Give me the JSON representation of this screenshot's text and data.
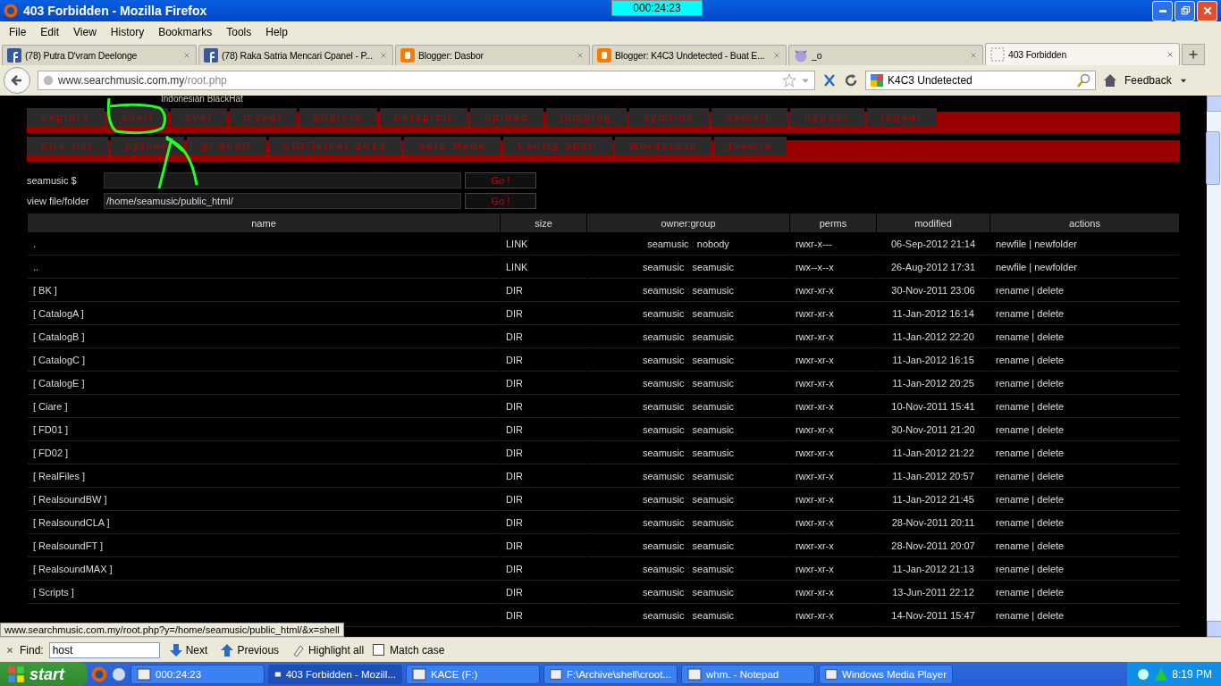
{
  "window": {
    "title": "403 Forbidden - Mozilla Firefox",
    "timer": "000:24:23"
  },
  "menu": [
    "File",
    "Edit",
    "View",
    "History",
    "Bookmarks",
    "Tools",
    "Help"
  ],
  "tabs": [
    {
      "label": "(78) Putra D'vram Deelonge",
      "kind": "facebook",
      "selected": false
    },
    {
      "label": "(78) Raka Satria Mencari Cpanel - P...",
      "kind": "facebook",
      "selected": false
    },
    {
      "label": "Blogger: Dasbor",
      "kind": "blogger",
      "selected": false
    },
    {
      "label": "Blogger: K4C3 Undetected - Buat E...",
      "kind": "blogger",
      "selected": false
    },
    {
      "label": "_o",
      "kind": "devil",
      "selected": false
    },
    {
      "label": "403 Forbidden",
      "kind": "blank",
      "selected": true
    }
  ],
  "navbar": {
    "url_host": "www.searchmusic.com.my",
    "url_path": "/root.php",
    "search": "K4C3 Undetected",
    "feedback": "Feedback"
  },
  "page": {
    "banner": "Indonesian BlackHat",
    "menu_rows": [
      [
        "explore",
        "shell",
        "eval",
        "mysql",
        "phpinfo",
        "netsploit",
        "upload",
        "jumping",
        "symlink",
        "domain",
        "bypass",
        "logout"
      ],
      [
        "Site list",
        "python",
        "gi Shell",
        "CGI-Telnet 2012",
        "Safe Mode",
        "Config Sh3ll",
        "Wordpress",
        "Joomla"
      ]
    ],
    "fields": [
      {
        "label": "seamusic $",
        "button": "Go !"
      },
      {
        "label": "view file/folder",
        "value": "/home/seamusic/public_html/",
        "button": "Go !"
      }
    ],
    "table": {
      "owner_group_separator": ":",
      "columns": [
        "name",
        "size",
        "owner:group",
        "perms",
        "modified",
        "actions"
      ],
      "rows": [
        {
          "name": ".",
          "size": "LINK",
          "owner": "seamusic",
          "group": "nobody",
          "perms": "rwxr-x---",
          "modified": "06-Sep-2012 21:14",
          "actions": "newfile | newfolder"
        },
        {
          "name": "..",
          "size": "LINK",
          "owner": "seamusic",
          "group": "seamusic",
          "perms": "rwx--x--x",
          "modified": "26-Aug-2012 17:31",
          "actions": "newfile | newfolder"
        },
        {
          "name": "[ BK ]",
          "size": "DIR",
          "owner": "seamusic",
          "group": "seamusic",
          "perms": "rwxr-xr-x",
          "modified": "30-Nov-2011 23:06",
          "actions": "rename | delete"
        },
        {
          "name": "[ CatalogA ]",
          "size": "DIR",
          "owner": "seamusic",
          "group": "seamusic",
          "perms": "rwxr-xr-x",
          "modified": "11-Jan-2012 16:14",
          "actions": "rename | delete"
        },
        {
          "name": "[ CatalogB ]",
          "size": "DIR",
          "owner": "seamusic",
          "group": "seamusic",
          "perms": "rwxr-xr-x",
          "modified": "11-Jan-2012 22:20",
          "actions": "rename | delete"
        },
        {
          "name": "[ CatalogC ]",
          "size": "DIR",
          "owner": "seamusic",
          "group": "seamusic",
          "perms": "rwxr-xr-x",
          "modified": "11-Jan-2012 16:15",
          "actions": "rename | delete"
        },
        {
          "name": "[ CatalogE ]",
          "size": "DIR",
          "owner": "seamusic",
          "group": "seamusic",
          "perms": "rwxr-xr-x",
          "modified": "11-Jan-2012 20:25",
          "actions": "rename | delete"
        },
        {
          "name": "[ Ciare ]",
          "size": "DIR",
          "owner": "seamusic",
          "group": "seamusic",
          "perms": "rwxr-xr-x",
          "modified": "10-Nov-2011 15:41",
          "actions": "rename | delete"
        },
        {
          "name": "[ FD01 ]",
          "size": "DIR",
          "owner": "seamusic",
          "group": "seamusic",
          "perms": "rwxr-xr-x",
          "modified": "30-Nov-2011 21:20",
          "actions": "rename | delete"
        },
        {
          "name": "[ FD02 ]",
          "size": "DIR",
          "owner": "seamusic",
          "group": "seamusic",
          "perms": "rwxr-xr-x",
          "modified": "11-Jan-2012 21:22",
          "actions": "rename | delete"
        },
        {
          "name": "[ RealFiles ]",
          "size": "DIR",
          "owner": "seamusic",
          "group": "seamusic",
          "perms": "rwxr-xr-x",
          "modified": "11-Jan-2012 20:57",
          "actions": "rename | delete"
        },
        {
          "name": "[ RealsoundBW ]",
          "size": "DIR",
          "owner": "seamusic",
          "group": "seamusic",
          "perms": "rwxr-xr-x",
          "modified": "11-Jan-2012 21:45",
          "actions": "rename | delete"
        },
        {
          "name": "[ RealsoundCLA ]",
          "size": "DIR",
          "owner": "seamusic",
          "group": "seamusic",
          "perms": "rwxr-xr-x",
          "modified": "28-Nov-2011 20:11",
          "actions": "rename | delete"
        },
        {
          "name": "[ RealsoundFT ]",
          "size": "DIR",
          "owner": "seamusic",
          "group": "seamusic",
          "perms": "rwxr-xr-x",
          "modified": "28-Nov-2011 20:07",
          "actions": "rename | delete"
        },
        {
          "name": "[ RealsoundMAX ]",
          "size": "DIR",
          "owner": "seamusic",
          "group": "seamusic",
          "perms": "rwxr-xr-x",
          "modified": "11-Jan-2012 21:13",
          "actions": "rename | delete"
        },
        {
          "name": "[ Scripts ]",
          "size": "DIR",
          "owner": "seamusic",
          "group": "seamusic",
          "perms": "rwxr-xr-x",
          "modified": "13-Jun-2011 22:12",
          "actions": "rename | delete"
        },
        {
          "size": "DIR",
          "owner": "seamusic",
          "group": "seamusic",
          "perms": "rwxr-xr-x",
          "modified": "14-Nov-2011 15:47",
          "actions": "rename | delete"
        }
      ]
    }
  },
  "status_bar": "www.searchmusic.com.my/root.php?y=/home/seamusic/public_html/&x=shell",
  "find_bar": {
    "label": "Find:",
    "value": "host",
    "next": "Next",
    "previous": "Previous",
    "highlight": "Highlight all",
    "match_case": "Match case",
    "match_case_checked": false
  },
  "taskbar": {
    "start": "start",
    "items": [
      {
        "label": "000:24:23",
        "selected": false
      },
      {
        "label": "403 Forbidden - Mozill...",
        "selected": true
      },
      {
        "label": "KACE (F:)",
        "selected": false
      },
      {
        "label": "F:\\Archive\\shell\\croot...",
        "selected": false
      },
      {
        "label": "whm. - Notepad",
        "selected": false
      },
      {
        "label": "Windows Media Player",
        "selected": false
      }
    ],
    "clock": "8:19 PM"
  }
}
